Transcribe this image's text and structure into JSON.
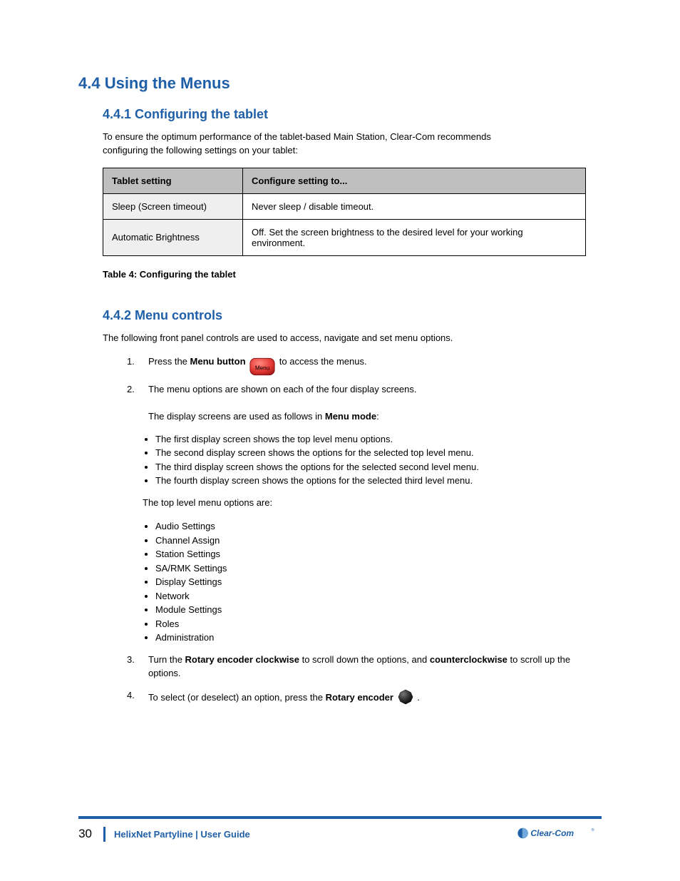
{
  "section4_4": {
    "heading": "4.4  Using the Menus",
    "sub": "4.4.1  Configuring the tablet",
    "intro_line1": "To ensure the optimum performance of the tablet-based Main Station, Clear-Com recommends",
    "intro_line2": "configuring the following settings on your tablet:",
    "table": {
      "head_left": "Tablet setting",
      "head_right": "Configure setting to...",
      "rows": [
        {
          "left": "Sleep (Screen timeout)",
          "right": "Never sleep / disable timeout."
        },
        {
          "left": "Automatic Brightness",
          "right": "Off. Set the screen brightness to the desired level for your working environment."
        }
      ]
    },
    "caption": "Table 4: Configuring the tablet"
  },
  "section4_4_2": {
    "heading": "4.4.2  Menu controls",
    "intro": "The following front panel controls are used to access, navigate and set menu options.",
    "step1": {
      "num": "1.",
      "prefix": "Press the ",
      "bold_menu": "Menu button",
      "label_in_img": "Menu",
      "after_img": " to access the menus."
    },
    "step2": {
      "num": "2.",
      "text": "The menu options are shown on each of the four display screens.",
      "sublabel1": "The display screens are used as follows in ",
      "bold_mm": "Menu mode",
      "list1": [
        "The first display screen shows the top level menu options.",
        "The second display screen shows the options for the selected top level menu.",
        "The third display screen shows the options for the selected second level menu.",
        "The fourth display screen shows the options for the selected third level menu."
      ],
      "sublabel2": "The top level menu options are:",
      "list2": [
        "Audio Settings",
        "Channel Assign",
        "Station Settings",
        "SA/RMK Settings",
        "Display Settings",
        "Network",
        "Module Settings",
        "Roles",
        "Administration"
      ]
    },
    "step3": {
      "num": "3.",
      "prefix": "Turn the ",
      "bold_re": "Rotary encoder clockwise",
      "mid": " to scroll down the options, and ",
      "bold_cc": "counterclockwise",
      "tail": " to scroll up the options."
    },
    "step4": {
      "num": "4.",
      "prefix": "To select (or deselect) an option, press the ",
      "bold_re2": "Rotary encoder",
      "tail": " ."
    }
  },
  "footer": {
    "page": "30",
    "title": "HelixNet Partyline | User Guide",
    "logo_text": "Clear-Com"
  }
}
